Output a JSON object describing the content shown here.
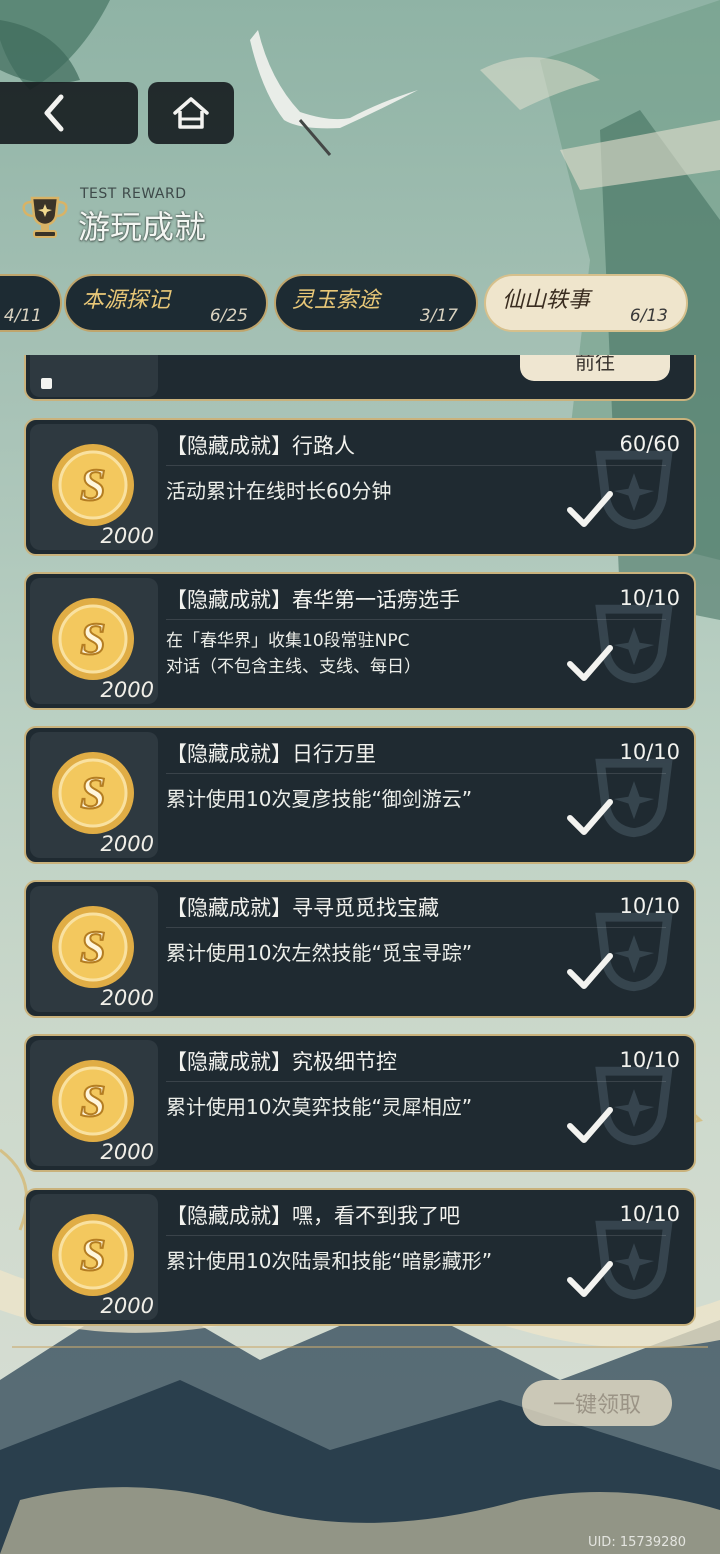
{
  "header": {
    "sub_title": "TEST REWARD",
    "title": "游玩成就"
  },
  "tabs": [
    {
      "name": "",
      "count": "4/11",
      "active": false
    },
    {
      "name": "本源探记",
      "count": "6/25",
      "active": false
    },
    {
      "name": "灵玉索途",
      "count": "3/17",
      "active": false
    },
    {
      "name": "仙山轶事",
      "count": "6/13",
      "active": true
    }
  ],
  "partial_item": {
    "go_label": "前往"
  },
  "achievements": [
    {
      "title": "【隐藏成就】行路人",
      "progress": "60/60",
      "description": "活动累计在线时长60分钟",
      "reward": "2000"
    },
    {
      "title": "【隐藏成就】春华第一话痨选手",
      "progress": "10/10",
      "description": "在「春华界」收集10段常驻NPC对话（不包含主线、支线、每日）",
      "reward": "2000"
    },
    {
      "title": "【隐藏成就】日行万里",
      "progress": "10/10",
      "description": "累计使用10次夏彦技能“御剑游云”",
      "reward": "2000"
    },
    {
      "title": "【隐藏成就】寻寻觅觅找宝藏",
      "progress": "10/10",
      "description": "累计使用10次左然技能“觅宝寻踪”",
      "reward": "2000"
    },
    {
      "title": "【隐藏成就】究极细节控",
      "progress": "10/10",
      "description": "累计使用10次莫弈技能“灵犀相应”",
      "reward": "2000"
    },
    {
      "title": "【隐藏成就】嘿，看不到我了吧",
      "progress": "10/10",
      "description": "累计使用10次陆景和技能“暗影藏形”",
      "reward": "2000"
    }
  ],
  "footer": {
    "claim_all_label": "一键领取",
    "uid": "UID: 15739280"
  },
  "colors": {
    "card_bg": "#1f2a31",
    "card_border": "#c9b27c",
    "tab_active_bg": "#efe5cc",
    "tab_name_gold": "#e9c878"
  }
}
